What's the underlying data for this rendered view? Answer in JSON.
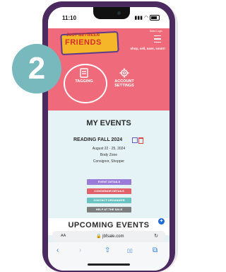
{
  "status_bar": {
    "time": "11:10"
  },
  "header": {
    "logo_top": "JUST BETWEEN",
    "logo_main": "FRIENDS",
    "tagline": "shop, sell, save, smart!",
    "links": "Sales  Login"
  },
  "tabs": {
    "tagging": "TAGGING",
    "account_line1": "ACCOUNT",
    "account_line2": "SETTINGS"
  },
  "step_badge": "2",
  "events": {
    "heading": "MY EVENTS",
    "sale_name": "READING FALL 2024",
    "dates": "August 22 - 25, 2024",
    "zone": "Body Zone",
    "roles": "Consignor, Shopper",
    "buttons": [
      "EVENT DETAILS",
      "CONSIGNOR DETAILS",
      "CONTACT ORGANIZER",
      "HELP AT THE SALE"
    ],
    "button_colors": [
      "#9b7bd8",
      "#e2626b",
      "#6ac3c0",
      "#7e7e7e"
    ]
  },
  "upcoming": "UPCOMING EVENTS",
  "browser": {
    "aa": "AA",
    "url": "jbfsale.com",
    "nav": {
      "back": "‹",
      "forward": "›",
      "share": "⇧",
      "books": "▯▯",
      "tabs": "⧉",
      "reload": "↻"
    }
  }
}
